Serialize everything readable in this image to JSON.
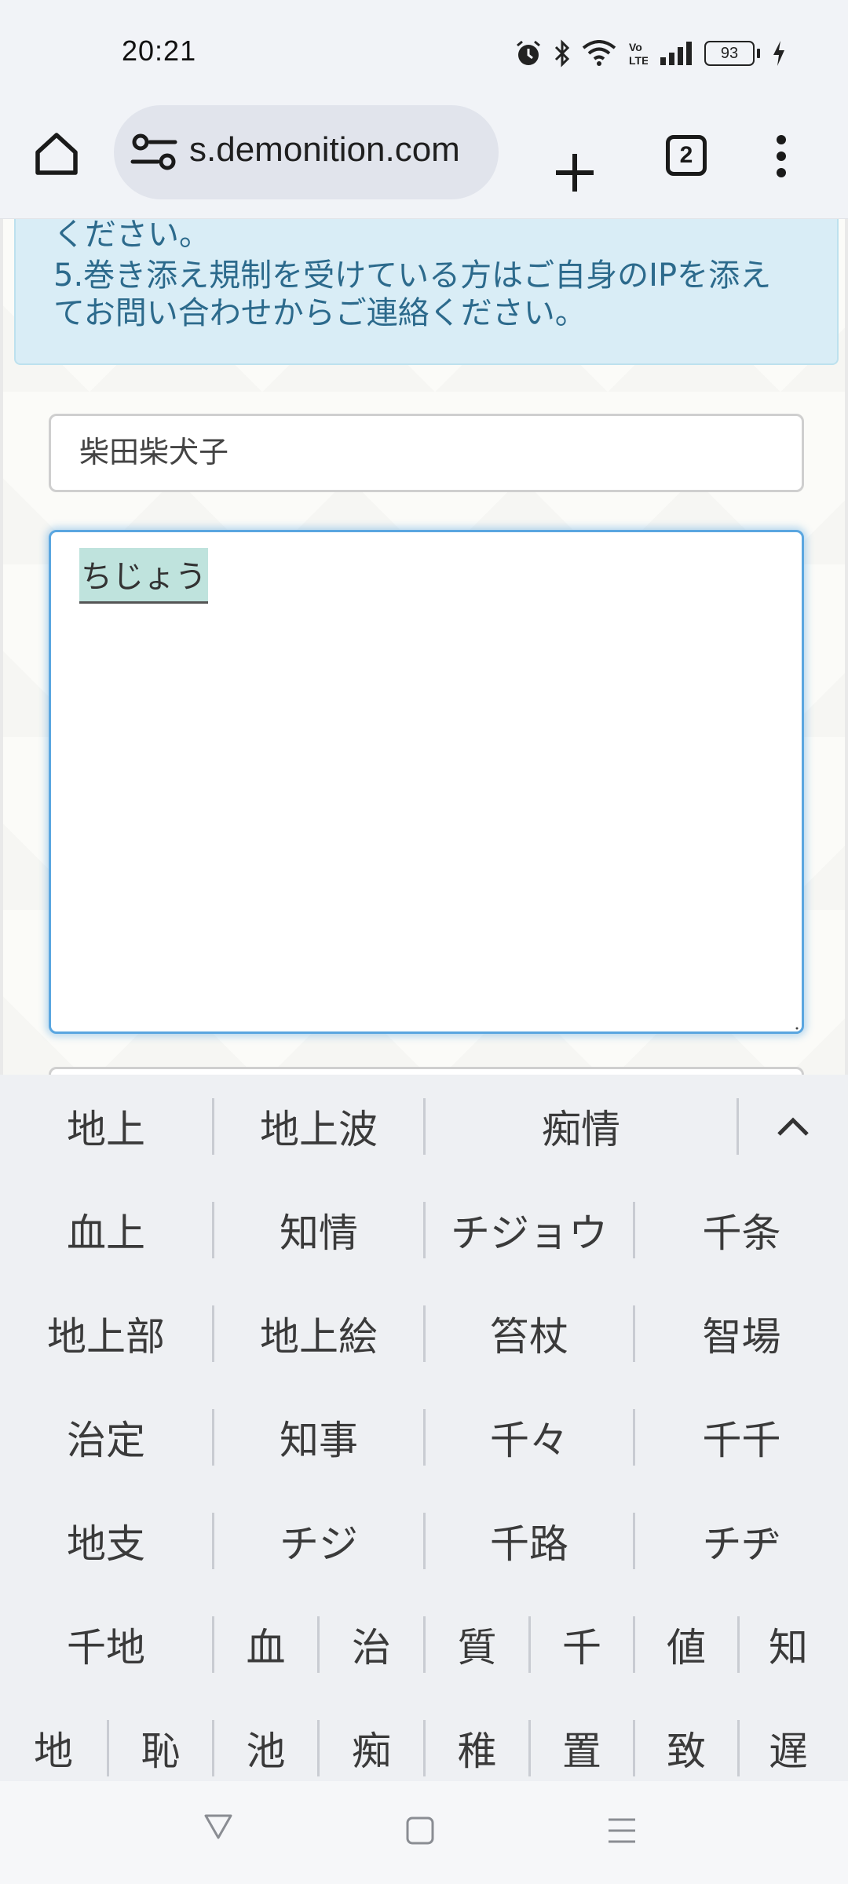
{
  "status_bar": {
    "time": "20:21",
    "battery": "93",
    "icons": [
      "alarm-icon",
      "bluetooth-icon",
      "wifi-icon",
      "volte-icon",
      "signal-icon",
      "battery-icon",
      "charging-icon"
    ]
  },
  "toolbar": {
    "url": "s.demonition.com",
    "tab_count": "2",
    "icons": [
      "home-icon",
      "site-settings-icon",
      "plus-icon",
      "tab-switcher-icon",
      "more-vert-icon"
    ]
  },
  "notice": {
    "line1": "ください。",
    "line2": "5.巻き添え規制を受けている方はご自身のIPを添え",
    "line3": "てお問い合わせからご連絡ください。"
  },
  "form": {
    "name_value": "柴田柴犬子",
    "message_composing": "ちじょう"
  },
  "ime": {
    "rows": [
      [
        "地上",
        "地上波",
        "痴情"
      ],
      [
        "血上",
        "知情",
        "チジョウ",
        "千条"
      ],
      [
        "地上部",
        "地上絵",
        "笞杖",
        "智場"
      ],
      [
        "治定",
        "知事",
        "千々",
        "千千"
      ],
      [
        "地支",
        "チジ",
        "千路",
        "チヂ"
      ],
      [
        "千地",
        "血",
        "治",
        "質",
        "千",
        "値",
        "知"
      ],
      [
        "地",
        "恥",
        "池",
        "痴",
        "稚",
        "置",
        "致",
        "遅"
      ]
    ]
  },
  "colors": {
    "notice_bg": "#d9edf6",
    "notice_text": "#2c6a8c",
    "focus_border": "#5aa6e0",
    "composing_highlight": "#bfe3dd",
    "ime_bg": "#eef0f3"
  }
}
